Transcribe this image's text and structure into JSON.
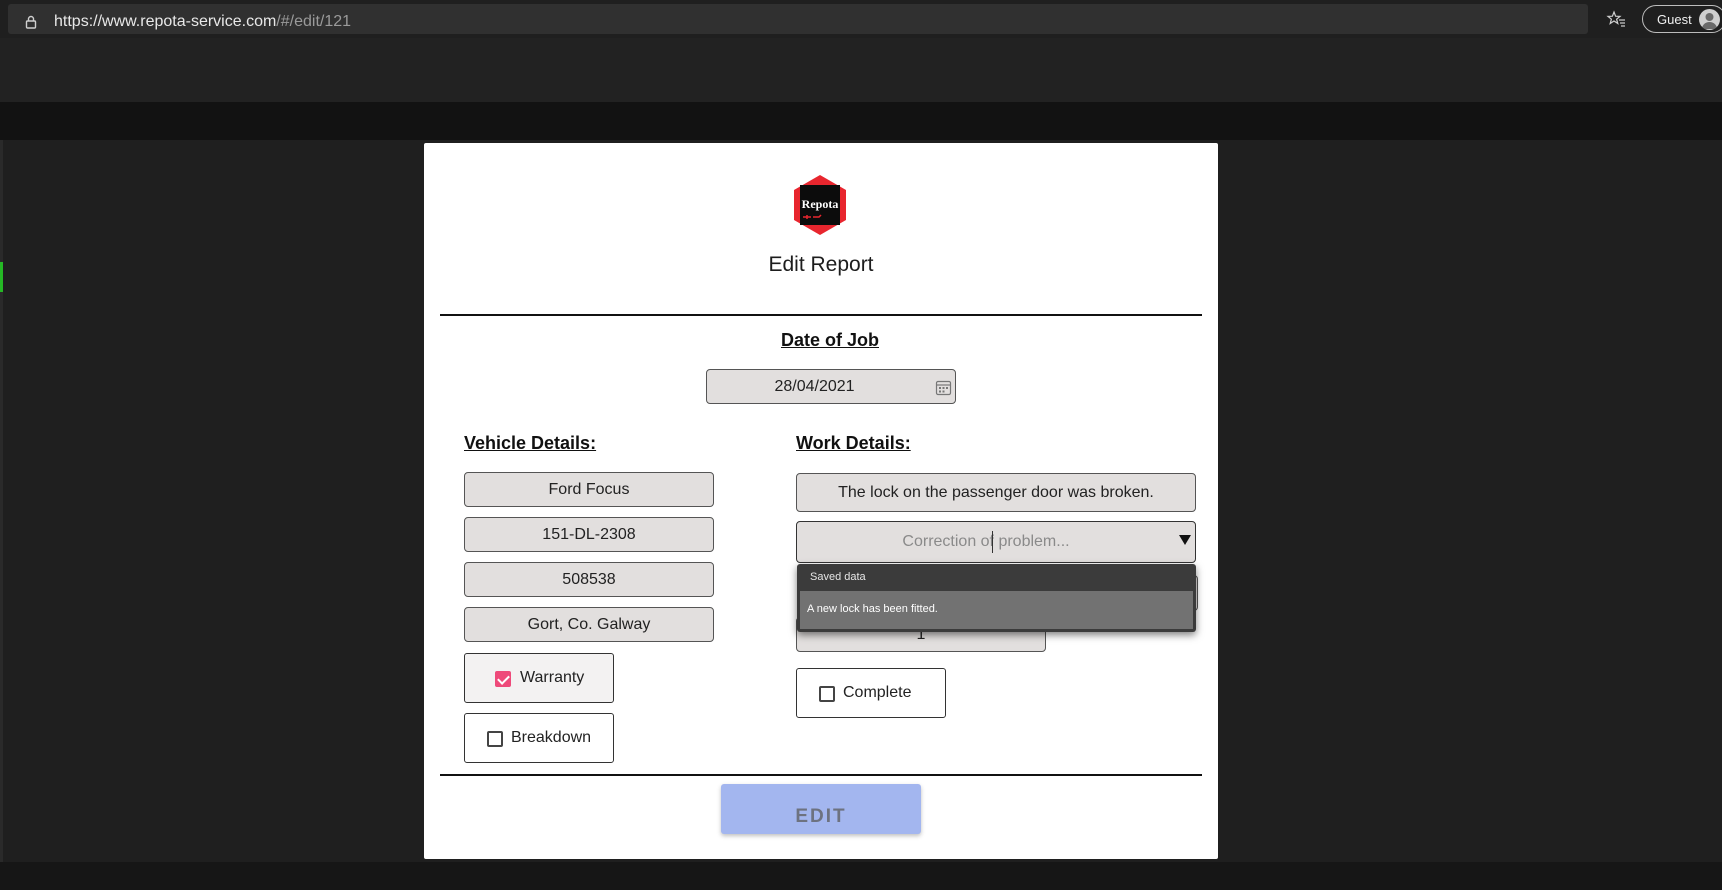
{
  "browser": {
    "url_host": "https://www.repota-service.com",
    "url_path": "/#/edit/121",
    "profile_label": "Guest"
  },
  "card": {
    "logo_text": "Repota",
    "title": "Edit Report",
    "date_heading": "Date of Job",
    "date_value": "28/04/2021"
  },
  "vehicle": {
    "heading": "Vehicle Details:",
    "make_model": "Ford Focus",
    "registration": "151-DL-2308",
    "mileage": "508538",
    "location": "Gort, Co. Galway",
    "warranty_label": "Warranty",
    "warranty_checked": true,
    "breakdown_label": "Breakdown",
    "breakdown_checked": false
  },
  "work": {
    "heading": "Work Details:",
    "problem": "The lock on the passenger door was broken.",
    "correction_placeholder": "Correction of problem...",
    "quantity": "1",
    "complete_label": "Complete",
    "complete_checked": false
  },
  "autofill": {
    "header": "Saved data",
    "suggestion": "A new lock has been fitted."
  },
  "actions": {
    "edit_label": "EDIT"
  },
  "colors": {
    "accent_pink": "#ee4a7a",
    "button_blue": "#a3b6ef",
    "field_gray": "#e2dfde",
    "logo_red": "#e8262e"
  }
}
